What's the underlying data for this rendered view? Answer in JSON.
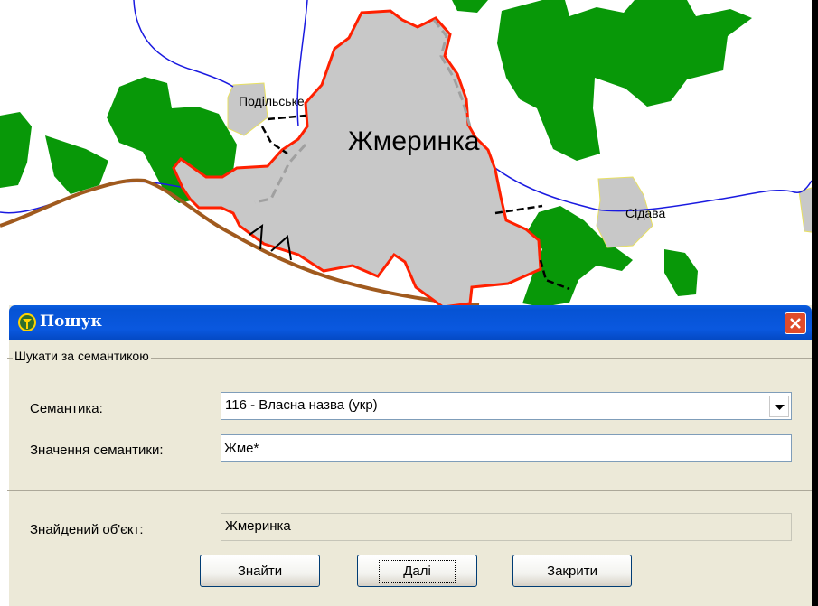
{
  "map": {
    "city_label": "Жмеринка",
    "village_labels": [
      "Подільське",
      "Сідава"
    ],
    "colors": {
      "forest": "#089808",
      "settlement_fill": "#c8c8c8",
      "city_border": "#ff2000",
      "river": "#1a1ae0",
      "road": "#a05a1e"
    }
  },
  "dialog": {
    "title": "Пошук",
    "group_label": "Шукати за семантикою",
    "semantics_label": "Семантика:",
    "semantics_value": "116 - Власна назва (укр)",
    "value_label": "Значення семантики:",
    "value_input": "Жме*",
    "found_label": "Знайдений об'єкт:",
    "found_value": "Жмеринка",
    "buttons": {
      "find": "Знайти",
      "next": "Далі",
      "close": "Закрити"
    }
  }
}
